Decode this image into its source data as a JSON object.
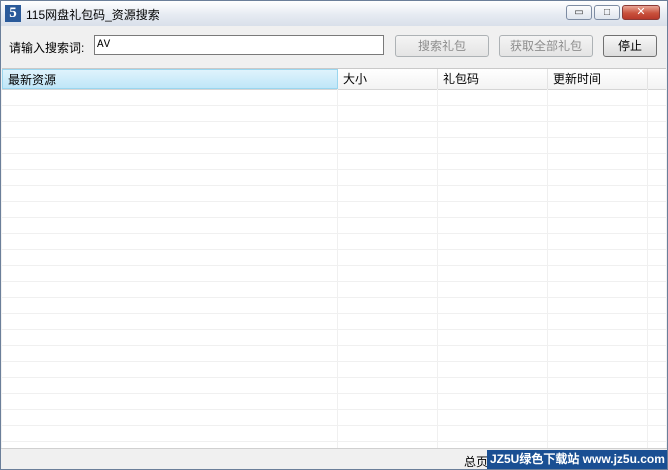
{
  "window": {
    "title": "115网盘礼包码_资源搜索",
    "icon_char": "5",
    "minimize_glyph": "▭",
    "maximize_glyph": "□",
    "close_glyph": "✕"
  },
  "search": {
    "label": "请输入搜索词:",
    "value": "AV",
    "search_button": "搜索礼包",
    "get_all_button": "获取全部礼包",
    "stop_button": "停止"
  },
  "table": {
    "columns": [
      "最新资源",
      "大小",
      "礼包码",
      "更新时间"
    ],
    "rows": []
  },
  "status": {
    "text": "总页:",
    "watermark": "JZ5U绿色下载站 www.jz5u.com"
  },
  "colors": {
    "accent_header": "#bfe6f8",
    "title_close": "#c9513c",
    "watermark_bg": "#1a4f93"
  }
}
